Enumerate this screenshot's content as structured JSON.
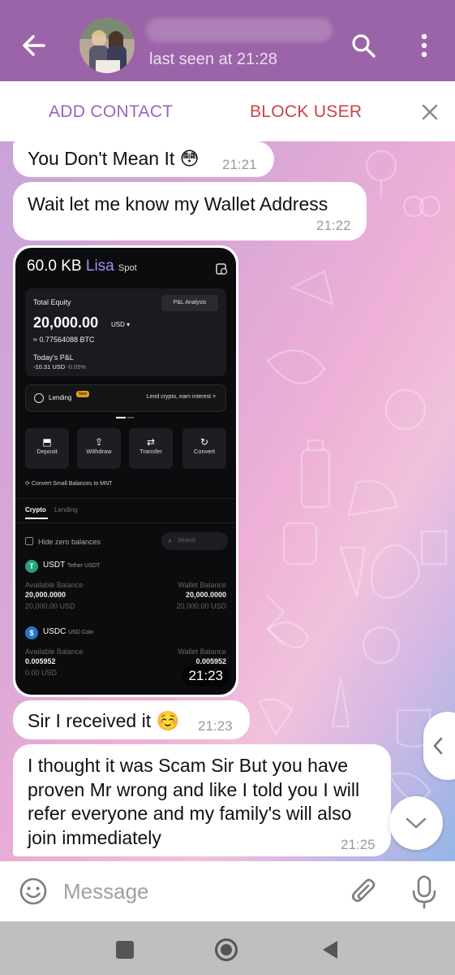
{
  "header": {
    "status": "last seen at 21:28"
  },
  "action_bar": {
    "add_contact": "ADD CONTACT",
    "block_user": "BLOCK USER"
  },
  "messages": [
    {
      "text": "You Don't Mean It 😳",
      "time": "21:21"
    },
    {
      "text": "Wait let me know my Wallet Address",
      "time": "21:22"
    },
    {
      "type": "photo",
      "time": "21:23"
    },
    {
      "text": "Sir I received it ☺️",
      "time": "21:23"
    },
    {
      "text": "I thought it was Scam Sir But you have proven Mr wrong and like I told you I will refer everyone and my family's will also join immediately",
      "time": "21:25"
    }
  ],
  "screenshot": {
    "size": "60.0 KB",
    "name": "Lisa",
    "mode": "Spot",
    "total_equity_label": "Total Equity",
    "pnl_analysis": "P&L Analysis",
    "equity_value": "20,000.00",
    "equity_currency": "USD ▾",
    "btc_value": "≈ 0.77564088 BTC",
    "todays_pnl_label": "Today's P&L",
    "pnl_value": "-10.31",
    "pnl_currency": "USD",
    "pnl_pct": "-0.05%",
    "lending_label": "Lending",
    "lending_badge": "New",
    "lending_cta": "Lend crypto, earn interest  >",
    "actions": [
      "Deposit",
      "Withdraw",
      "Transfer",
      "Convert"
    ],
    "convert_small": "Convert Small Balances to MNT",
    "tabs": [
      "Crypto",
      "Lending"
    ],
    "hide_zero": "Hide zero balances",
    "search_placeholder": "Search",
    "assets": [
      {
        "symbol": "USDT",
        "name": "Tether USDT",
        "available_label": "Available Balance",
        "wallet_label": "Wallet Balance",
        "available": "20,000.0000",
        "available_usd": "20,000.00 USD",
        "wallet": "20,000.0000",
        "wallet_usd": "20,000.00 USD",
        "color": "#26a17b",
        "glyph": "T"
      },
      {
        "symbol": "USDC",
        "name": "USD Coin",
        "available_label": "Available Balance",
        "wallet_label": "Wallet Balance",
        "available": "0.005952",
        "available_usd": "0.00 USD",
        "wallet": "0.005952",
        "wallet_usd": "",
        "color": "#2775ca",
        "glyph": "$"
      }
    ]
  },
  "input": {
    "placeholder": "Message"
  },
  "colors": {
    "header": "#9b64a8",
    "add_contact": "#9b64c0",
    "block_user": "#c8434a"
  }
}
